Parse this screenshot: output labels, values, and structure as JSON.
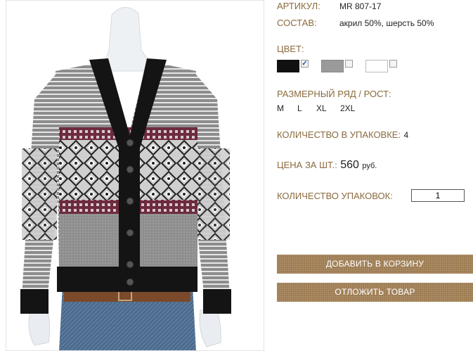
{
  "product": {
    "article_label": "АРТИКУЛ:",
    "article_value": "MR 807-17",
    "composition_label": "СОСТАВ:",
    "composition_value": "акрил 50%, шерсть 50%",
    "color_label": "ЦВЕТ:",
    "colors": [
      {
        "name": "black",
        "hex": "#111111",
        "checked": true
      },
      {
        "name": "grey",
        "hex": "#9a9a9a",
        "checked": false
      },
      {
        "name": "white",
        "hex": "#ffffff",
        "checked": false
      }
    ],
    "size_label": "РАЗМЕРНЫЙ РЯД / РОСТ:",
    "sizes": [
      "M",
      "L",
      "XL",
      "2XL"
    ],
    "pack_qty_label": "КОЛИЧЕСТВО В УПАКОВКЕ:",
    "pack_qty_value": "4",
    "price_label": "ЦЕНА ЗА ШТ.:",
    "price_value": "560",
    "price_currency": "руб.",
    "packs_label": "КОЛИЧЕСТВО УПАКОВОК:",
    "packs_value": "1"
  },
  "actions": {
    "add_to_cart": "ДОБАВИТЬ В КОРЗИНУ",
    "postpone": "ОТЛОЖИТЬ ТОВАР"
  },
  "colors": {
    "label_accent": "#8a6a3e",
    "button_bg": "#9c7a4f"
  }
}
